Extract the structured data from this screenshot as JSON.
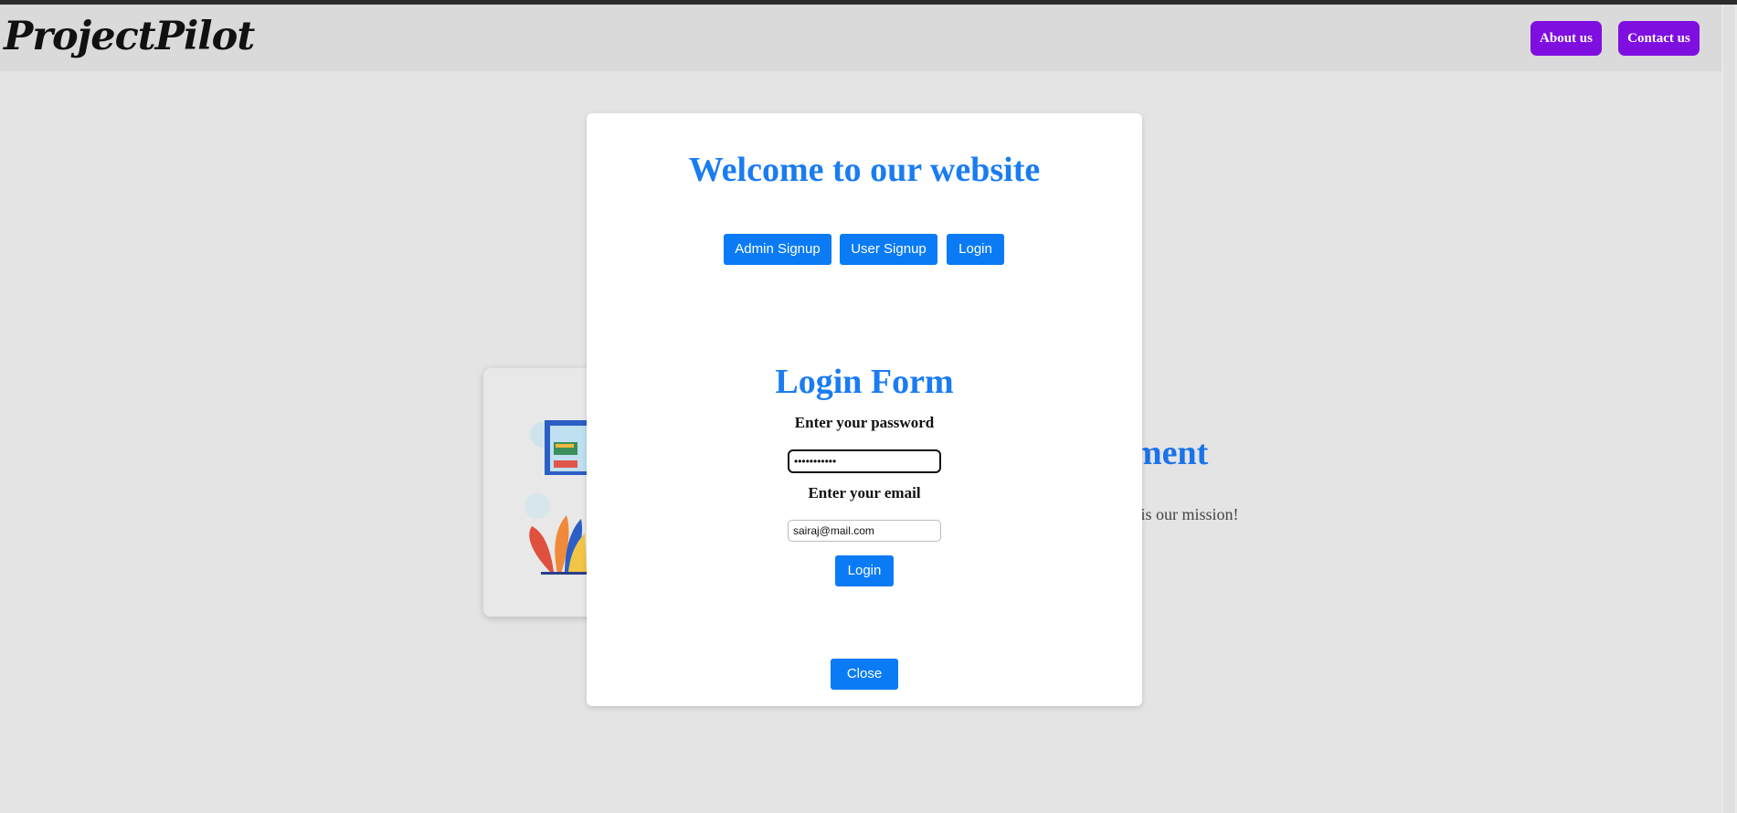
{
  "navbar": {
    "logo": "ProjectPilot",
    "about_label": "About us",
    "contact_label": "Contact us"
  },
  "background": {
    "heading_fragment": "ment",
    "text_fragment": "r is our mission!"
  },
  "modal": {
    "title": "Welcome to our website",
    "tabs": {
      "admin_signup": "Admin Signup",
      "user_signup": "User Signup",
      "login": "Login"
    },
    "form": {
      "title": "Login Form",
      "password_label": "Enter your password",
      "password_value": "•••••••••••",
      "email_label": "Enter your email",
      "email_value": "sairaj@mail.com",
      "submit_label": "Login"
    },
    "close_label": "Close"
  },
  "colors": {
    "accent_blue": "#0a7bf5",
    "title_blue": "#1a7cf0",
    "nav_purple": "#7f0fe0"
  }
}
